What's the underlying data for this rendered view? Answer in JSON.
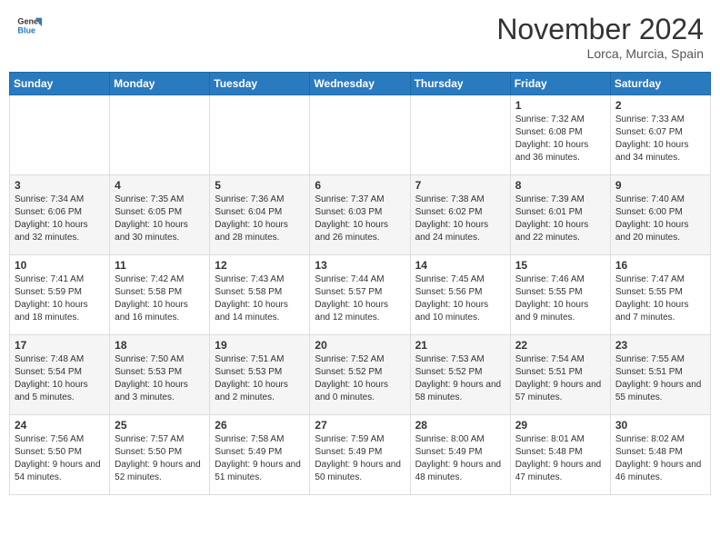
{
  "header": {
    "logo_general": "General",
    "logo_blue": "Blue",
    "month_title": "November 2024",
    "location": "Lorca, Murcia, Spain"
  },
  "days_of_week": [
    "Sunday",
    "Monday",
    "Tuesday",
    "Wednesday",
    "Thursday",
    "Friday",
    "Saturday"
  ],
  "weeks": [
    [
      {
        "day": "",
        "info": ""
      },
      {
        "day": "",
        "info": ""
      },
      {
        "day": "",
        "info": ""
      },
      {
        "day": "",
        "info": ""
      },
      {
        "day": "",
        "info": ""
      },
      {
        "day": "1",
        "info": "Sunrise: 7:32 AM\nSunset: 6:08 PM\nDaylight: 10 hours and 36 minutes."
      },
      {
        "day": "2",
        "info": "Sunrise: 7:33 AM\nSunset: 6:07 PM\nDaylight: 10 hours and 34 minutes."
      }
    ],
    [
      {
        "day": "3",
        "info": "Sunrise: 7:34 AM\nSunset: 6:06 PM\nDaylight: 10 hours and 32 minutes."
      },
      {
        "day": "4",
        "info": "Sunrise: 7:35 AM\nSunset: 6:05 PM\nDaylight: 10 hours and 30 minutes."
      },
      {
        "day": "5",
        "info": "Sunrise: 7:36 AM\nSunset: 6:04 PM\nDaylight: 10 hours and 28 minutes."
      },
      {
        "day": "6",
        "info": "Sunrise: 7:37 AM\nSunset: 6:03 PM\nDaylight: 10 hours and 26 minutes."
      },
      {
        "day": "7",
        "info": "Sunrise: 7:38 AM\nSunset: 6:02 PM\nDaylight: 10 hours and 24 minutes."
      },
      {
        "day": "8",
        "info": "Sunrise: 7:39 AM\nSunset: 6:01 PM\nDaylight: 10 hours and 22 minutes."
      },
      {
        "day": "9",
        "info": "Sunrise: 7:40 AM\nSunset: 6:00 PM\nDaylight: 10 hours and 20 minutes."
      }
    ],
    [
      {
        "day": "10",
        "info": "Sunrise: 7:41 AM\nSunset: 5:59 PM\nDaylight: 10 hours and 18 minutes."
      },
      {
        "day": "11",
        "info": "Sunrise: 7:42 AM\nSunset: 5:58 PM\nDaylight: 10 hours and 16 minutes."
      },
      {
        "day": "12",
        "info": "Sunrise: 7:43 AM\nSunset: 5:58 PM\nDaylight: 10 hours and 14 minutes."
      },
      {
        "day": "13",
        "info": "Sunrise: 7:44 AM\nSunset: 5:57 PM\nDaylight: 10 hours and 12 minutes."
      },
      {
        "day": "14",
        "info": "Sunrise: 7:45 AM\nSunset: 5:56 PM\nDaylight: 10 hours and 10 minutes."
      },
      {
        "day": "15",
        "info": "Sunrise: 7:46 AM\nSunset: 5:55 PM\nDaylight: 10 hours and 9 minutes."
      },
      {
        "day": "16",
        "info": "Sunrise: 7:47 AM\nSunset: 5:55 PM\nDaylight: 10 hours and 7 minutes."
      }
    ],
    [
      {
        "day": "17",
        "info": "Sunrise: 7:48 AM\nSunset: 5:54 PM\nDaylight: 10 hours and 5 minutes."
      },
      {
        "day": "18",
        "info": "Sunrise: 7:50 AM\nSunset: 5:53 PM\nDaylight: 10 hours and 3 minutes."
      },
      {
        "day": "19",
        "info": "Sunrise: 7:51 AM\nSunset: 5:53 PM\nDaylight: 10 hours and 2 minutes."
      },
      {
        "day": "20",
        "info": "Sunrise: 7:52 AM\nSunset: 5:52 PM\nDaylight: 10 hours and 0 minutes."
      },
      {
        "day": "21",
        "info": "Sunrise: 7:53 AM\nSunset: 5:52 PM\nDaylight: 9 hours and 58 minutes."
      },
      {
        "day": "22",
        "info": "Sunrise: 7:54 AM\nSunset: 5:51 PM\nDaylight: 9 hours and 57 minutes."
      },
      {
        "day": "23",
        "info": "Sunrise: 7:55 AM\nSunset: 5:51 PM\nDaylight: 9 hours and 55 minutes."
      }
    ],
    [
      {
        "day": "24",
        "info": "Sunrise: 7:56 AM\nSunset: 5:50 PM\nDaylight: 9 hours and 54 minutes."
      },
      {
        "day": "25",
        "info": "Sunrise: 7:57 AM\nSunset: 5:50 PM\nDaylight: 9 hours and 52 minutes."
      },
      {
        "day": "26",
        "info": "Sunrise: 7:58 AM\nSunset: 5:49 PM\nDaylight: 9 hours and 51 minutes."
      },
      {
        "day": "27",
        "info": "Sunrise: 7:59 AM\nSunset: 5:49 PM\nDaylight: 9 hours and 50 minutes."
      },
      {
        "day": "28",
        "info": "Sunrise: 8:00 AM\nSunset: 5:49 PM\nDaylight: 9 hours and 48 minutes."
      },
      {
        "day": "29",
        "info": "Sunrise: 8:01 AM\nSunset: 5:48 PM\nDaylight: 9 hours and 47 minutes."
      },
      {
        "day": "30",
        "info": "Sunrise: 8:02 AM\nSunset: 5:48 PM\nDaylight: 9 hours and 46 minutes."
      }
    ]
  ]
}
